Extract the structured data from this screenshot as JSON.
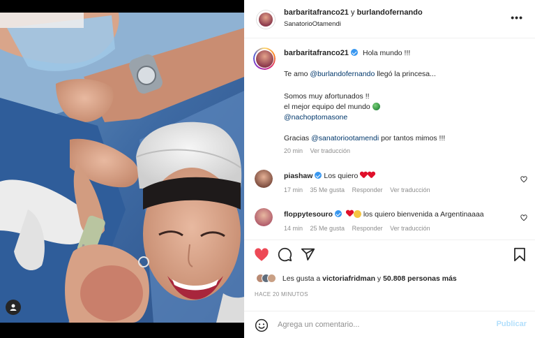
{
  "header": {
    "user1": "barbaritafranco21",
    "joiner": "y",
    "user2": "burlandofernando",
    "location": "SanatorioOtamendi",
    "more_icon": "more-horizontal-icon"
  },
  "caption": {
    "username": "barbaritafranco21",
    "line1": "Hola mundo !!!",
    "line2_prefix": "Te amo",
    "line2_mention": "@burlandofernando",
    "line2_suffix": "llegó la princesa...",
    "line3": "Somos muy afortunados !!",
    "line4": "el mejor equipo del mundo",
    "line5_mention": "@nachoptomasone",
    "line6_prefix": "Gracias",
    "line6_mention": "@sanatoriootamendi",
    "line6_suffix": "por tantos mimos !!!",
    "time": "20 min",
    "translate": "Ver traducción"
  },
  "comments": [
    {
      "username": "piashaw",
      "text": "Los quiero",
      "time": "17 min",
      "likes": "35 Me gusta",
      "reply": "Responder",
      "translate": "Ver traducción",
      "avatar_color": "#b5876b"
    },
    {
      "username": "floppytesouro",
      "text": "los quiero bienvenida a Argentinaaaa",
      "time": "14 min",
      "likes": "25 Me gusta",
      "reply": "Responder",
      "translate": "Ver traducción",
      "avatar_color": "#c98a6e"
    }
  ],
  "actions": {
    "liked": true,
    "heart_color": "#ed4956",
    "likes_prefix": "Les gusta a",
    "likes_user": "victoriafridman",
    "likes_and": "y",
    "likes_count": "50.808 personas más",
    "time_ago": "HACE 20 MINUTOS"
  },
  "comment_box": {
    "placeholder": "Agrega un comentario...",
    "publish": "Publicar"
  },
  "colors": {
    "verified": "#3897f0",
    "mention": "#00376b",
    "publish_disabled": "#b2dffc"
  }
}
